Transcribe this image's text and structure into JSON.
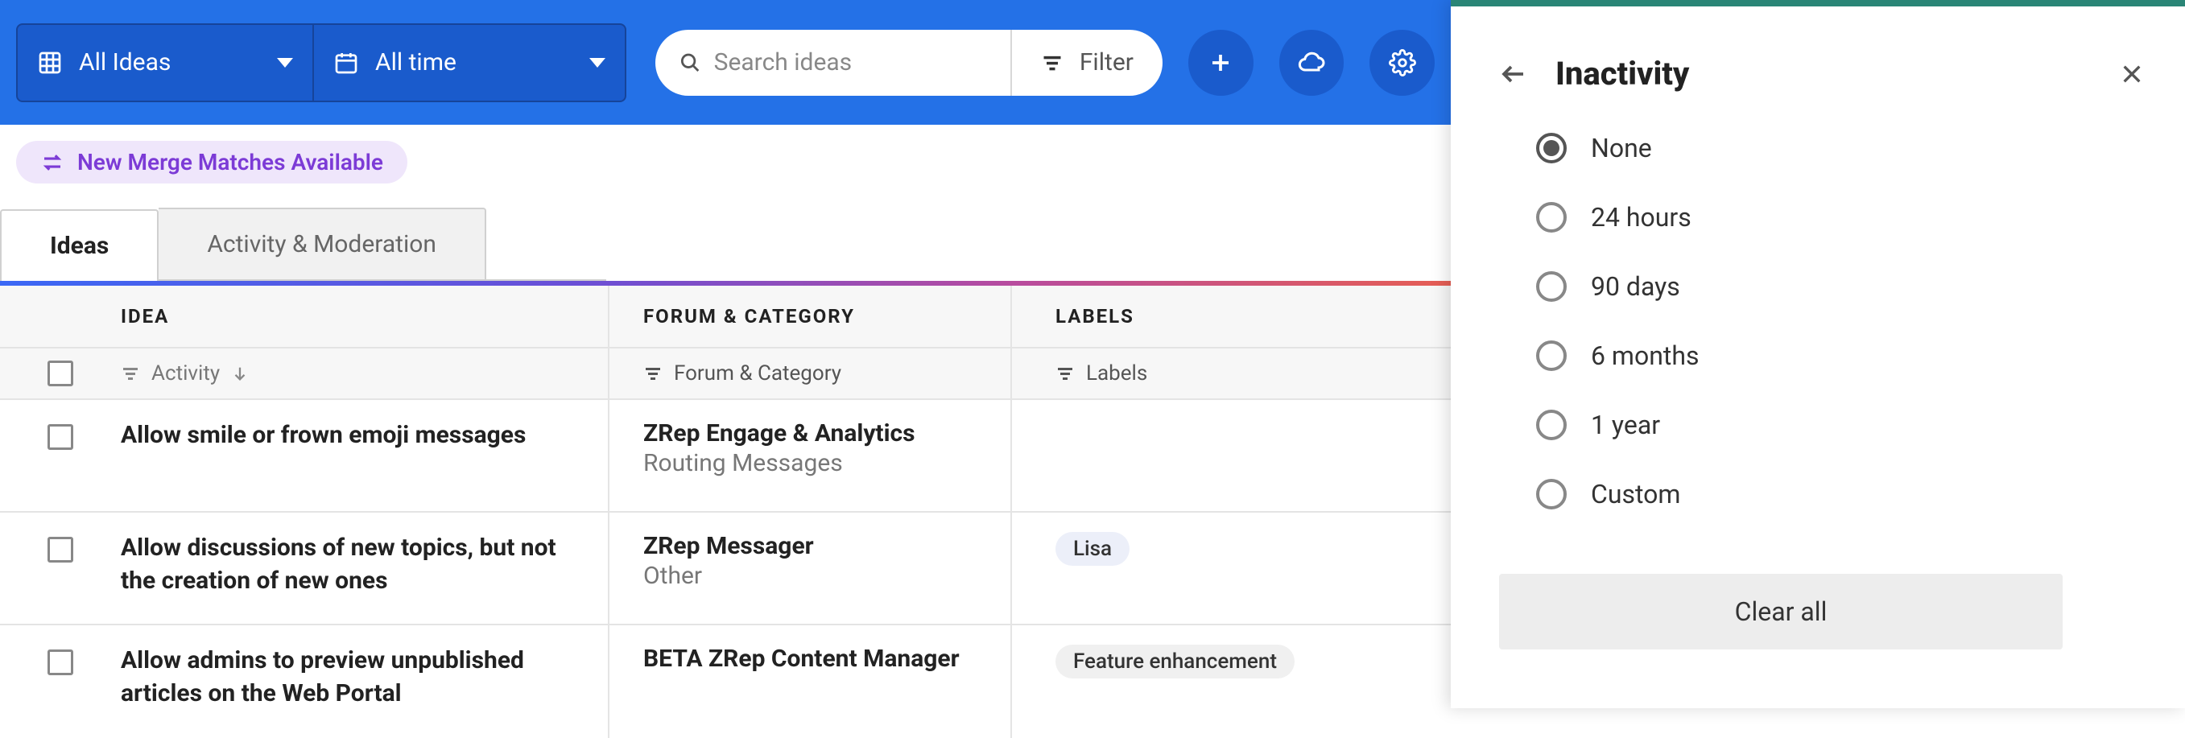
{
  "toolbar": {
    "dropdown_all_ideas": "All Ideas",
    "dropdown_all_time": "All time",
    "search_placeholder": "Search ideas",
    "filter_label": "Filter"
  },
  "merge_banner": "New Merge Matches Available",
  "tabs": {
    "ideas": "Ideas",
    "activity": "Activity & Moderation"
  },
  "table": {
    "headers": {
      "idea": "IDEA",
      "forum": "FORUM & CATEGORY",
      "labels": "LABELS"
    },
    "filters": {
      "activity": "Activity",
      "forum": "Forum & Category",
      "labels": "Labels"
    },
    "rows": [
      {
        "idea": "Allow smile or frown emoji messages",
        "forum": "ZRep Engage & Analytics",
        "category": "Routing Messages",
        "labels": []
      },
      {
        "idea": "Allow discussions of new topics, but not the creation of new ones",
        "forum": "ZRep Messager",
        "category": "Other",
        "labels": [
          "Lisa"
        ]
      },
      {
        "idea": "Allow admins to preview unpublished articles on the Web Portal",
        "forum": "BETA ZRep Content Manager",
        "category": "",
        "labels": [
          "Feature enhancement"
        ]
      }
    ]
  },
  "panel": {
    "title": "Inactivity",
    "options": [
      {
        "label": "None",
        "selected": true
      },
      {
        "label": "24 hours",
        "selected": false
      },
      {
        "label": "90 days",
        "selected": false
      },
      {
        "label": "6 months",
        "selected": false
      },
      {
        "label": "1 year",
        "selected": false
      },
      {
        "label": "Custom",
        "selected": false
      }
    ],
    "clear_all": "Clear all"
  }
}
